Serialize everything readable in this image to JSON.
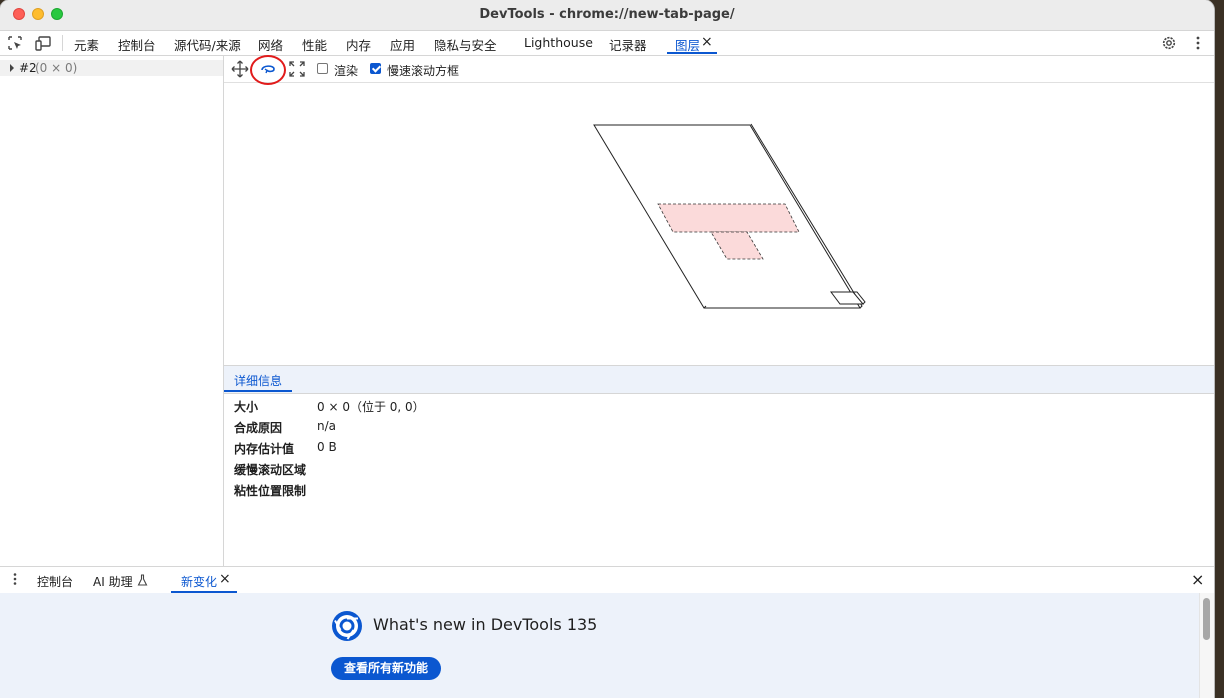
{
  "window": {
    "title": "DevTools - chrome://new-tab-page/"
  },
  "main_tabs": [
    {
      "label": "元素"
    },
    {
      "label": "控制台"
    },
    {
      "label": "源代码/来源"
    },
    {
      "label": "网络"
    },
    {
      "label": "性能"
    },
    {
      "label": "内存"
    },
    {
      "label": "应用"
    },
    {
      "label": "隐私与安全"
    },
    {
      "label": "Lighthouse"
    },
    {
      "label": "记录器"
    },
    {
      "label": "图层",
      "active": true
    }
  ],
  "tab_close": "×",
  "layer_tree": {
    "item": {
      "label": "#2",
      "dims": "(0 × 0)"
    }
  },
  "layers_toolbar": {
    "paints_label": "渲染",
    "paints_checked": false,
    "slow_scroll_label": "慢速滚动方框",
    "slow_scroll_checked": true
  },
  "details": {
    "tab_label": "详细信息",
    "rows": [
      {
        "key": "大小",
        "value": "0 × 0（位于 0, 0）"
      },
      {
        "key": "合成原因",
        "value": "n/a"
      },
      {
        "key": "内存估计值",
        "value": "0 B"
      },
      {
        "key": "缓慢滚动区域",
        "value": ""
      },
      {
        "key": "粘性位置限制",
        "value": ""
      }
    ]
  },
  "drawer": {
    "tabs": [
      {
        "label": "控制台"
      },
      {
        "label": "AI 助理"
      },
      {
        "label": "新变化",
        "active": true
      }
    ],
    "close": "×",
    "whats_new_title": "What's new in DevTools 135",
    "cta_label": "查看所有新功能"
  },
  "colors": {
    "accent": "#0b57d0",
    "layer_fill": "#fbdada",
    "annotation_red": "#e11b1b"
  }
}
